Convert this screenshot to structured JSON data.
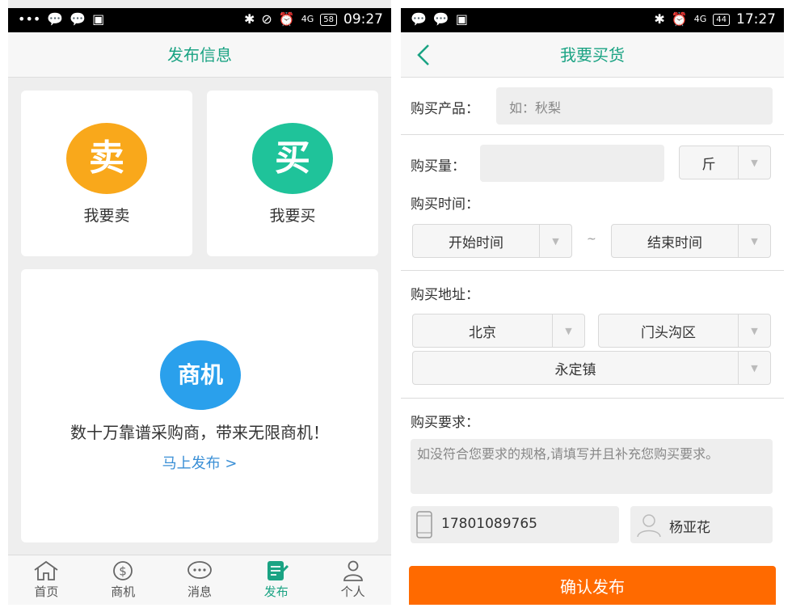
{
  "left": {
    "status": {
      "time": "09:27",
      "battery": "58",
      "network": "4G"
    },
    "title": "发布信息",
    "sell": {
      "icon_char": "卖",
      "label": "我要卖"
    },
    "buy": {
      "icon_char": "买",
      "label": "我要买"
    },
    "opportunity": {
      "icon_char": "商机",
      "text": "数十万靠谱采购商，带来无限商机！",
      "link": "马上发布 >"
    },
    "tabs": [
      {
        "label": "首页",
        "icon": "home-icon"
      },
      {
        "label": "商机",
        "icon": "dollar-icon"
      },
      {
        "label": "消息",
        "icon": "message-icon"
      },
      {
        "label": "发布",
        "icon": "publish-icon",
        "active": true
      },
      {
        "label": "个人",
        "icon": "person-icon"
      }
    ]
  },
  "right": {
    "status": {
      "time": "17:27",
      "battery": "44",
      "network": "4G"
    },
    "title": "我要买货",
    "product": {
      "label": "购买产品：",
      "placeholder": "如：秋梨"
    },
    "quantity": {
      "label": "购买量：",
      "value": "",
      "unit": "斤"
    },
    "time": {
      "label": "购买时间：",
      "start": "开始时间",
      "tilde": "~",
      "end": "结束时间"
    },
    "address": {
      "label": "购买地址：",
      "city": "北京",
      "district": "门头沟区",
      "town": "永定镇"
    },
    "requirement": {
      "label": "购买要求：",
      "placeholder": "如没符合您要求的规格,请填写并且补充您购买要求。"
    },
    "phone": "17801089765",
    "contact_name": "杨亚花",
    "submit_label": "确认发布"
  },
  "colors": {
    "accent": "#1aa383",
    "sell": "#f9a81b",
    "buy": "#1fc39a",
    "opportunity": "#2aa0ec",
    "submit": "#ff6a00"
  }
}
